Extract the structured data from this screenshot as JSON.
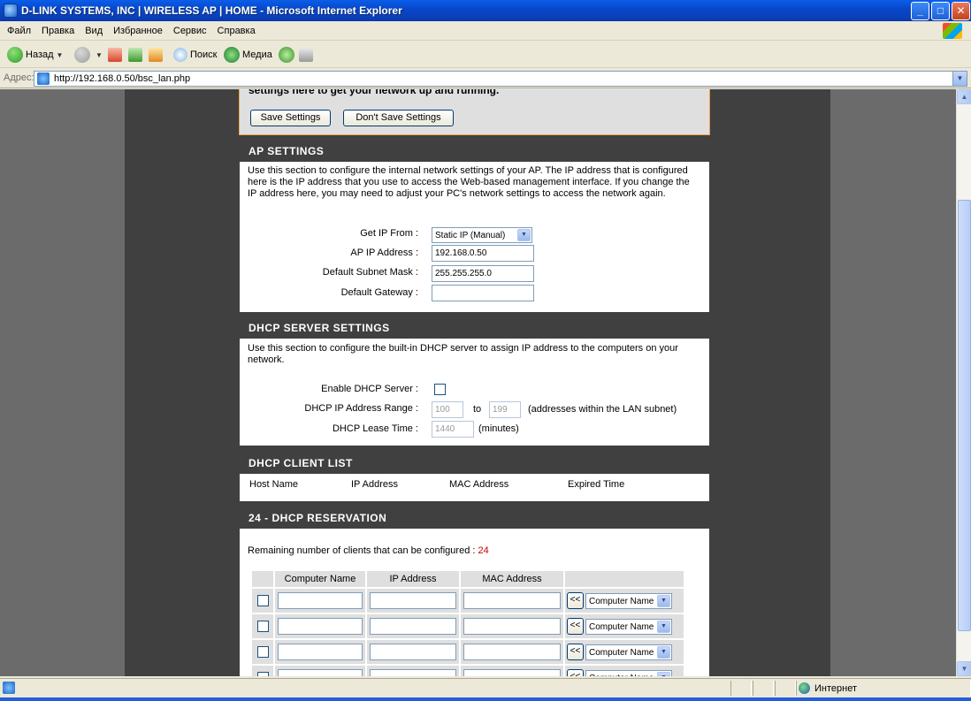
{
  "window": {
    "title": "D-LINK SYSTEMS, INC | WIRELESS AP | HOME - Microsoft Internet Explorer",
    "min_label": "_",
    "max_label": "□",
    "close_label": "✕"
  },
  "menu": [
    "Файл",
    "Правка",
    "Вид",
    "Избранное",
    "Сервис",
    "Справка"
  ],
  "toolbar": {
    "back_label": "Назад",
    "search_label": "Поиск",
    "media_label": "Медиа"
  },
  "address": {
    "label": "Адрес:",
    "url": "http://192.168.0.50/bsc_lan.php"
  },
  "intro": {
    "partial_text": "settings here to get your network up and running.",
    "save_label": "Save Settings",
    "dont_save_label": "Don't Save Settings"
  },
  "ap_settings": {
    "header": "AP SETTINGS",
    "description": "Use this section to configure the internal network settings of your AP. The IP address that is configured here is the IP address that you use to access the Web-based management interface. If you change the IP address here, you may need to adjust your PC's network settings to access the network again.",
    "get_ip_label": "Get IP From :",
    "get_ip_value": "Static IP (Manual)",
    "ip_label": "AP IP Address :",
    "ip_value": "192.168.0.50",
    "mask_label": "Default Subnet Mask :",
    "mask_value": "255.255.255.0",
    "gateway_label": "Default Gateway :",
    "gateway_value": ""
  },
  "dhcp_server": {
    "header": "DHCP SERVER SETTINGS",
    "description": "Use this section to configure the built-in DHCP server to assign IP address to the computers on your network.",
    "enable_label": "Enable DHCP Server :",
    "enabled": false,
    "range_label": "DHCP IP Address Range :",
    "range_start": "100",
    "range_to": "to",
    "range_end": "199",
    "range_note": "(addresses within the LAN subnet)",
    "lease_label": "DHCP Lease Time :",
    "lease_value": "1440",
    "lease_unit": "(minutes)"
  },
  "dhcp_clients": {
    "header": "DHCP CLIENT LIST",
    "columns": [
      "Host Name",
      "IP Address",
      "MAC Address",
      "Expired Time"
    ]
  },
  "dhcp_reservation": {
    "header": "24 - DHCP RESERVATION",
    "remaining_label": "Remaining number of clients that can be configured :",
    "remaining_count": "24",
    "columns": [
      "Computer Name",
      "IP Address",
      "MAC Address"
    ],
    "copy_button_label": "<<",
    "computer_select_value": "Computer Name"
  },
  "status": {
    "zone": "Интернет"
  },
  "colors": {
    "section_header_bg": "#404040",
    "page_bg": "#6B6B6B",
    "remaining_count": "#CC0000",
    "intro_border": "#F0A050"
  }
}
